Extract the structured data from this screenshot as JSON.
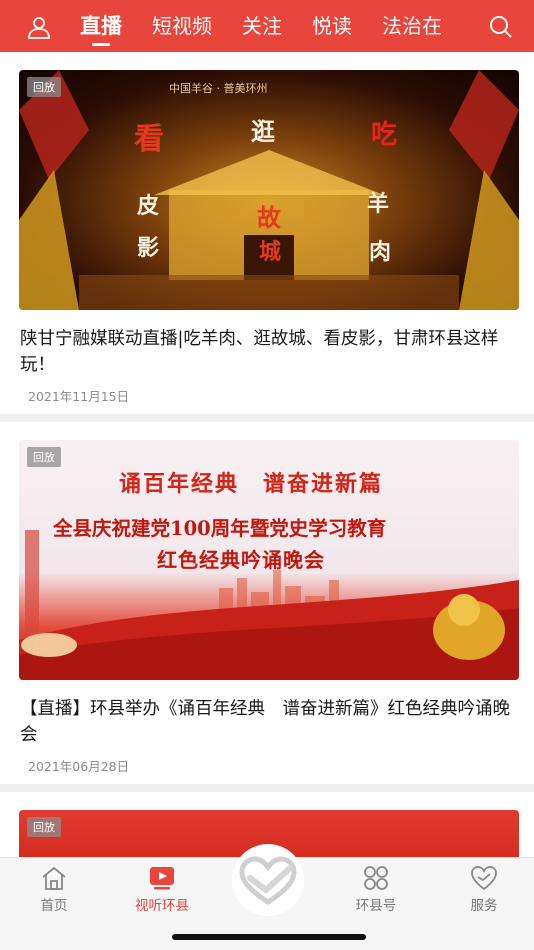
{
  "header": {
    "tabs": [
      {
        "label": "直播",
        "active": true
      },
      {
        "label": "短视频",
        "active": false
      },
      {
        "label": "关注",
        "active": false
      },
      {
        "label": "悦读",
        "active": false
      },
      {
        "label": "法治在",
        "active": false
      }
    ],
    "user_icon": "user-icon",
    "search_icon": "search-icon",
    "color": "#e8453c"
  },
  "feed": {
    "items": [
      {
        "badge": "回放",
        "title": "陕甘宁融媒联动直播|吃羊肉、逛故城、看皮影，甘肃环县这样玩！",
        "date": "2021年11月15日",
        "thumb_text": {
          "top": "中国羊谷 · 普美环州",
          "words": [
            "看",
            "逛",
            "吃",
            "皮",
            "故",
            "羊",
            "影",
            "城",
            "肉"
          ]
        }
      },
      {
        "badge": "回放",
        "title": "【直播】环县举办《诵百年经典　谱奋进新篇》红色经典吟诵晚会",
        "date": "2021年06月28日",
        "thumb_text": {
          "line1": "诵百年经典　谱奋进新篇",
          "line2": "全县庆祝建党100周年暨党史学习教育",
          "line3": "红色经典吟诵晚会"
        }
      },
      {
        "badge": "回放"
      }
    ]
  },
  "bottom_nav": {
    "items": [
      {
        "label": "首页",
        "icon": "home-icon",
        "active": false
      },
      {
        "label": "视听环县",
        "icon": "video-icon",
        "active": true
      },
      {
        "label": "",
        "icon": "heart-hands-icon",
        "active": false
      },
      {
        "label": "环县号",
        "icon": "grid-icon",
        "active": false
      },
      {
        "label": "服务",
        "icon": "heart-icon",
        "active": false
      }
    ],
    "active_color": "#e8453c"
  }
}
